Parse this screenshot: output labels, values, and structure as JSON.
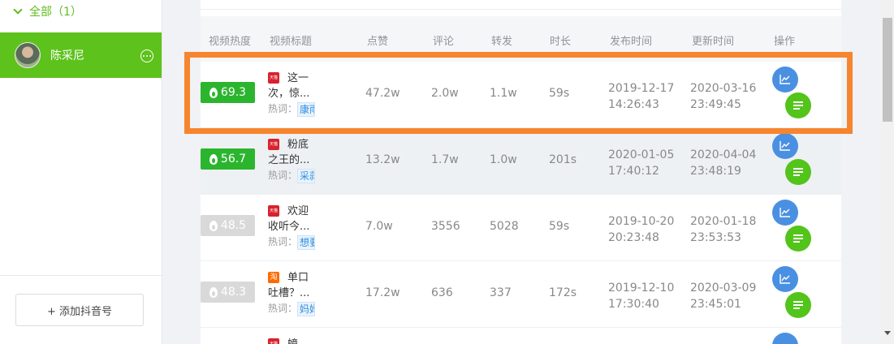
{
  "sidebar": {
    "group_label": "全部（1）",
    "account_name": "陈采尼",
    "add_button_label": "+ 添加抖音号"
  },
  "table": {
    "headers": [
      "视频热度",
      "视频标题",
      "点赞",
      "评论",
      "转发",
      "时长",
      "发布时间",
      "更新时间",
      "操作"
    ],
    "keyword_label": "热词：",
    "rows": [
      {
        "heat": "69.3",
        "heat_state": "hot",
        "app_icon": "tmall-icon",
        "title_line1": "这一",
        "title_line2": "次，惊...",
        "keyword": "康雨",
        "likes": "47.2w",
        "comments": "2.0w",
        "shares": "1.1w",
        "duration": "59s",
        "publish_date": "2019-12-17",
        "publish_time": "14:26:43",
        "update_date": "2020-03-16",
        "update_time": "23:49:45"
      },
      {
        "heat": "56.7",
        "heat_state": "hot",
        "app_icon": "tmall-icon",
        "title_line1": "粉底",
        "title_line2": "之王的...",
        "keyword": "采蒜",
        "likes": "13.2w",
        "comments": "1.7w",
        "shares": "1.0w",
        "duration": "201s",
        "publish_date": "2020-01-05",
        "publish_time": "17:40:12",
        "update_date": "2020-04-04",
        "update_time": "23:48:19"
      },
      {
        "heat": "48.5",
        "heat_state": "cold",
        "app_icon": "tmall-icon",
        "title_line1": "欢迎",
        "title_line2": "收听今...",
        "keyword": "想要",
        "likes": "7.0w",
        "comments": "3556",
        "shares": "5028",
        "duration": "59s",
        "publish_date": "2019-10-20",
        "publish_time": "20:23:48",
        "update_date": "2020-01-18",
        "update_time": "23:53:53"
      },
      {
        "heat": "48.3",
        "heat_state": "cold",
        "app_icon": "taobao-icon",
        "title_line1": "单口",
        "title_line2": "吐槽？...",
        "keyword": "妈妈",
        "likes": "17.2w",
        "comments": "636",
        "shares": "337",
        "duration": "172s",
        "publish_date": "2019-12-10",
        "publish_time": "17:30:40",
        "update_date": "2020-03-09",
        "update_time": "23:45:01"
      },
      {
        "heat": "",
        "heat_state": "cold",
        "app_icon": "tmall-icon",
        "title_line1": "蟑",
        "title_line2": "",
        "keyword": "",
        "likes": "",
        "comments": "",
        "shares": "",
        "duration": "",
        "publish_date": "",
        "publish_time": "",
        "update_date": "",
        "update_time": ""
      }
    ]
  },
  "colors": {
    "accent_green": "#5ec21c",
    "heat_hot": "#2bb52e",
    "heat_cold": "#d9d9d9",
    "chart_button": "#4a90e2",
    "list_button": "#52c41a",
    "highlight": "#f7852e"
  }
}
